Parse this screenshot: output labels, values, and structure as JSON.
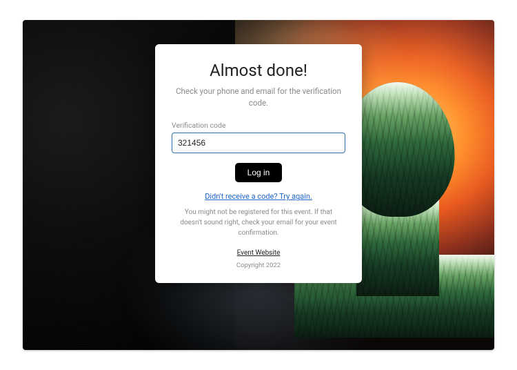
{
  "card": {
    "title": "Almost done!",
    "subtitle": "Check your phone and email for the verification code.",
    "field_label": "Verification code",
    "code_value": "321456",
    "login_label": "Log in",
    "resend_label": "Didn't receive a code? Try again.",
    "note": "You might not be registered for this event. If that doesn't sound right, check your email for your event confirmation.",
    "site_link_label": "Event Website",
    "copyright": "Copyright 2022"
  }
}
